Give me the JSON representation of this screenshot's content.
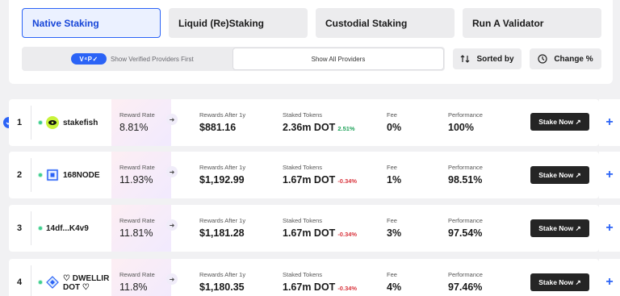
{
  "tabs": [
    {
      "label": "Native Staking",
      "active": true
    },
    {
      "label": "Liquid (Re)Staking",
      "active": false
    },
    {
      "label": "Custodial Staking",
      "active": false
    },
    {
      "label": "Run A Validator",
      "active": false
    }
  ],
  "filter": {
    "verified_badge": "V⁴P✓",
    "verified_label": "Show Verified Providers First",
    "all_label": "Show All Providers",
    "selected": "Show All Providers"
  },
  "controls": {
    "sort_label": "Sorted by",
    "change_label": "Change %"
  },
  "colors": {
    "accent": "#2b63f6",
    "positive": "#1fa25a",
    "negative": "#d9363e",
    "button": "#252525"
  },
  "labels": {
    "reward_rate": "Reward Rate",
    "rewards_after": "Rewards After 1y",
    "staked": "Staked Tokens",
    "fee": "Fee",
    "performance": "Performance",
    "stake_button": "Stake Now ↗",
    "expand": "+"
  },
  "providers": [
    {
      "rank": "1",
      "name": "stakefish",
      "name2": "",
      "reward_rate": "8.81%",
      "rewards_after": "$881.16",
      "staked": "2.36m DOT",
      "change": "2.51%",
      "change_dir": "positive",
      "fee": "0%",
      "performance": "100%",
      "verified": true,
      "logo_icon": "fish-eye-icon"
    },
    {
      "rank": "2",
      "name": "168NODE",
      "name2": "",
      "reward_rate": "11.93%",
      "rewards_after": "$1,192.99",
      "staked": "1.67m DOT",
      "change": "-0.34%",
      "change_dir": "negative",
      "fee": "1%",
      "performance": "98.51%",
      "verified": false,
      "logo_icon": "node-cube-icon"
    },
    {
      "rank": "3",
      "name": "14df...K4v9",
      "name2": "",
      "reward_rate": "11.81%",
      "rewards_after": "$1,181.28",
      "staked": "1.67m DOT",
      "change": "-0.34%",
      "change_dir": "negative",
      "fee": "3%",
      "performance": "97.54%",
      "verified": false,
      "logo_icon": ""
    },
    {
      "rank": "4",
      "name": "♡ DWELLIR",
      "name2": "DOT ♡",
      "reward_rate": "11.8%",
      "rewards_after": "$1,180.35",
      "staked": "1.67m DOT",
      "change": "-0.34%",
      "change_dir": "negative",
      "fee": "4%",
      "performance": "97.46%",
      "verified": false,
      "logo_icon": "dwellir-diamond-icon"
    }
  ]
}
